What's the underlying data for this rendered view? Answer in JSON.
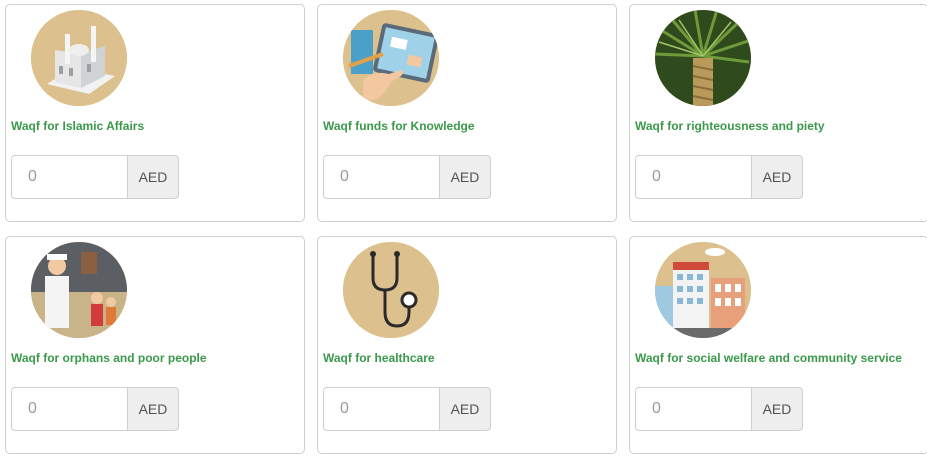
{
  "cards": [
    {
      "title": "Waqf for Islamic Affairs",
      "amount_placeholder": "0",
      "currency": "AED",
      "icon": "mosque-icon"
    },
    {
      "title": "Waqf funds for Knowledge",
      "amount_placeholder": "0",
      "currency": "AED",
      "icon": "tablet-learning-icon"
    },
    {
      "title": "Waqf for righteousness and piety",
      "amount_placeholder": "0",
      "currency": "AED",
      "icon": "palm-tree-icon"
    },
    {
      "title": "Waqf for orphans and poor people",
      "amount_placeholder": "0",
      "currency": "AED",
      "icon": "family-icon"
    },
    {
      "title": "Waqf for healthcare",
      "amount_placeholder": "0",
      "currency": "AED",
      "icon": "stethoscope-icon"
    },
    {
      "title": "Waqf for social welfare and community service",
      "amount_placeholder": "0",
      "currency": "AED",
      "icon": "city-buildings-icon"
    }
  ],
  "colors": {
    "title_green": "#3a9a4a",
    "icon_bg": "#dcc18e",
    "addon_bg": "#eeeeee",
    "border": "#cfcfcf"
  }
}
